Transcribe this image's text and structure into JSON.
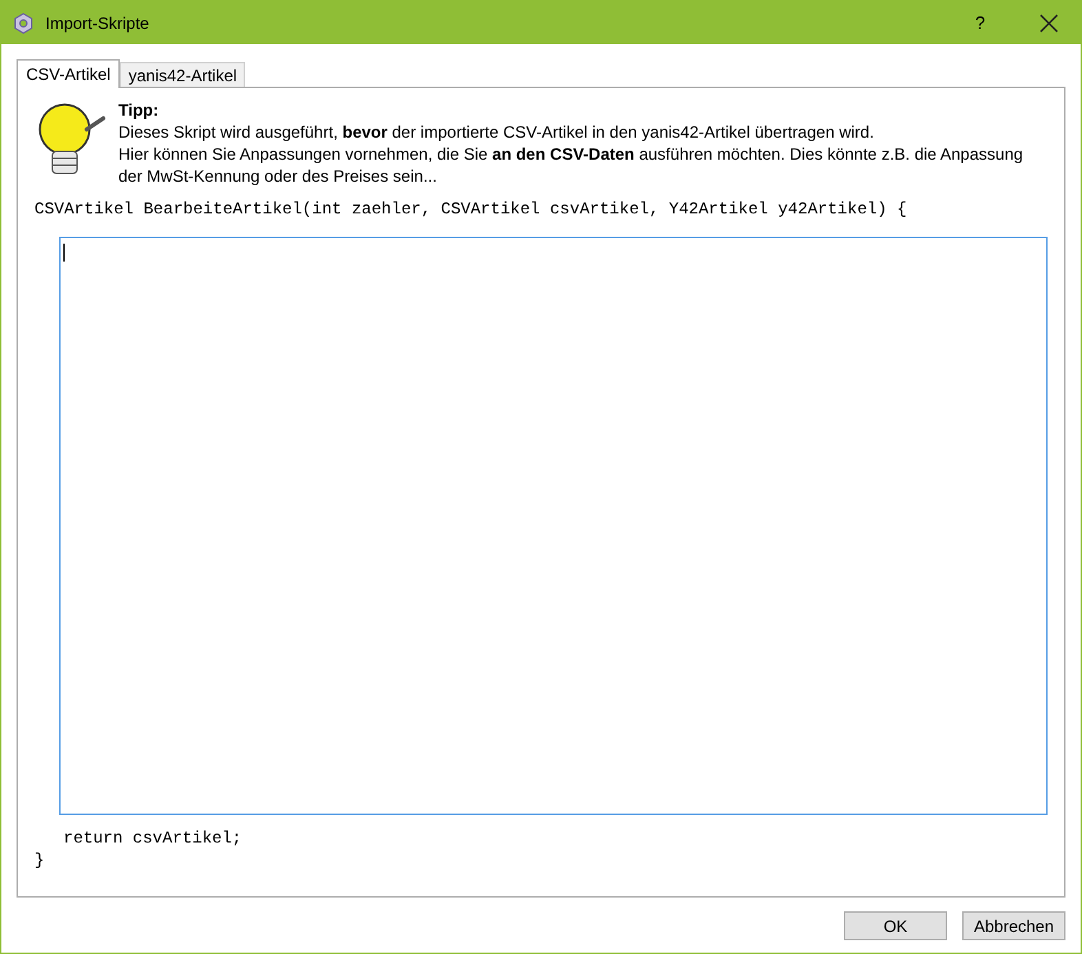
{
  "window": {
    "title": "Import-Skripte",
    "help": "?"
  },
  "tabs": [
    {
      "label": "CSV-Artikel",
      "selected": true
    },
    {
      "label": "yanis42-Artikel",
      "selected": false
    }
  ],
  "tip": {
    "title": "Tipp:",
    "lines": [
      "Dieses Skript wird ausgeführt, **bevor** der importierte CSV-Artikel in den yanis42-Artikel übertragen wird.",
      "Hier können Sie Anpassungen vornehmen, die Sie **an den CSV-Daten** ausführen möchten. Dies könnte z.B. die Anpassung der MwSt-Kennung oder des Preises sein..."
    ]
  },
  "code_header": "CSVArtikel BearbeiteArtikel(int zaehler, CSVArtikel csvArtikel, Y42Artikel y42Artikel) {",
  "code_return": "return csvArtikel;",
  "code_close": "}",
  "buttons": [
    "OK",
    "Abbrechen"
  ]
}
